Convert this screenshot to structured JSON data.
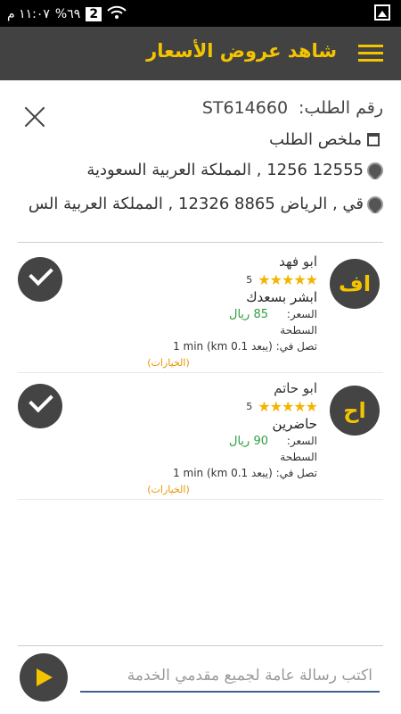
{
  "status_bar": {
    "time": "١١:٠٧ م",
    "battery": "%٦٩",
    "sim_badge": "2"
  },
  "app_bar": {
    "title": "شاهد عروض الأسعار"
  },
  "order": {
    "label": "رقم الطلب:",
    "number": "ST614660",
    "summary_label": "ملخص الطلب",
    "address_from": "12555 1256 , المملكة العربية السعودية",
    "address_to": "قي , الرياض 8865 12326 , المملكة العربية الس"
  },
  "offers": [
    {
      "initials": "اف",
      "name": "ابو فهد",
      "stars": "★★★★★",
      "rating": "5",
      "service": "ابشر بسعدك",
      "price_label": "السعر:",
      "price": "85 ريال",
      "surface_label": "السطحة",
      "arrival": "تصل في: (يبعد 0.1 km) 1 min",
      "options_label": "(الخيارات)"
    },
    {
      "initials": "اح",
      "name": "ابو حاتم",
      "stars": "★★★★★",
      "rating": "5",
      "service": "حاضرين",
      "price_label": "السعر:",
      "price": "90 ريال",
      "surface_label": "السطحة",
      "arrival": "تصل في: (يبعد 0.1 km) 1 min",
      "options_label": "(الخيارات)"
    }
  ],
  "composer": {
    "placeholder": "اكتب رسالة عامة لجميع مقدمي الخدمة"
  },
  "colors": {
    "accent": "#f5c400",
    "app_bar": "#424242",
    "price": "#2e9e3e",
    "options": "#e69500"
  }
}
